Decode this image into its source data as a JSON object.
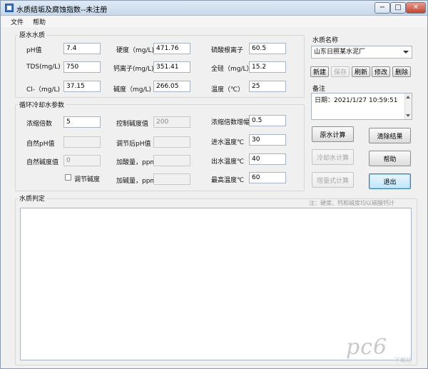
{
  "window": {
    "title": "水质结垢及腐蚀指数--未注册"
  },
  "titlebar_buttons": {
    "minimize": "−",
    "maximize": "□",
    "close": "✕"
  },
  "menu": [
    "文件",
    "帮助"
  ],
  "raw_water": {
    "title": "原水水质",
    "fields": [
      {
        "label": "pH值",
        "value": "7.4"
      },
      {
        "label": "硬度（mg/L)",
        "value": "471.76"
      },
      {
        "label": "硫酸根离子",
        "value": "60.5"
      },
      {
        "label": "TDS(mg/L)",
        "value": "750"
      },
      {
        "label": "钙离子(mg/L)",
        "value": "351.41"
      },
      {
        "label": "全硅（mg/L）",
        "value": "15.2"
      },
      {
        "label": "Cl-（mg/L)",
        "value": "37.15"
      },
      {
        "label": "碱度（mg/L)",
        "value": "266.05"
      },
      {
        "label": "温度（℃）",
        "value": "25"
      }
    ]
  },
  "cooling": {
    "title": "循环冷却水参数",
    "concentration_label": "浓缩倍数",
    "concentration_value": "5",
    "control_alk_label": "控制碱度值",
    "control_alk_value": "200",
    "conc_increment_label": "浓缩倍数增幅",
    "conc_increment_value": "0.5",
    "natural_ph_label": "自然pH值",
    "natural_ph_value": "",
    "adjusted_ph_label": "调节后pH值",
    "adjusted_ph_value": "",
    "inlet_temp_label": "进水温度℃",
    "inlet_temp_value": "30",
    "natural_alk_label": "自然碱度值",
    "natural_alk_value": "0",
    "acid_label": "加酸量，ppm",
    "acid_value": "",
    "outlet_temp_label": "出水温度℃",
    "outlet_temp_value": "40",
    "adjust_alk_label": "调节碱度",
    "adjust_alk_checked": false,
    "alkali_label": "加碱量，ppm",
    "alkali_value": "",
    "max_temp_label": "最高温度℃",
    "max_temp_value": "60"
  },
  "water_name": {
    "label": "水质名称",
    "selected": "山东日照某水泥厂",
    "buttons": {
      "new": "新建",
      "save": "保存",
      "refresh": "刷新",
      "edit": "修改",
      "delete": "删除"
    }
  },
  "remarks": {
    "label": "备注",
    "text": "日期：2021/1/27 10:59:51"
  },
  "actions": {
    "raw_calc": "原水计算",
    "clear": "清除结果",
    "cooling_calc": "冷却水计算",
    "help": "帮助",
    "increment_calc": "增量式计算",
    "exit": "退出"
  },
  "judgment": {
    "title": "水质判定",
    "note": "注：硬度、钙和碱度均以碳酸钙计"
  },
  "watermark": {
    "main": "pc6",
    "sub": "下载站"
  }
}
